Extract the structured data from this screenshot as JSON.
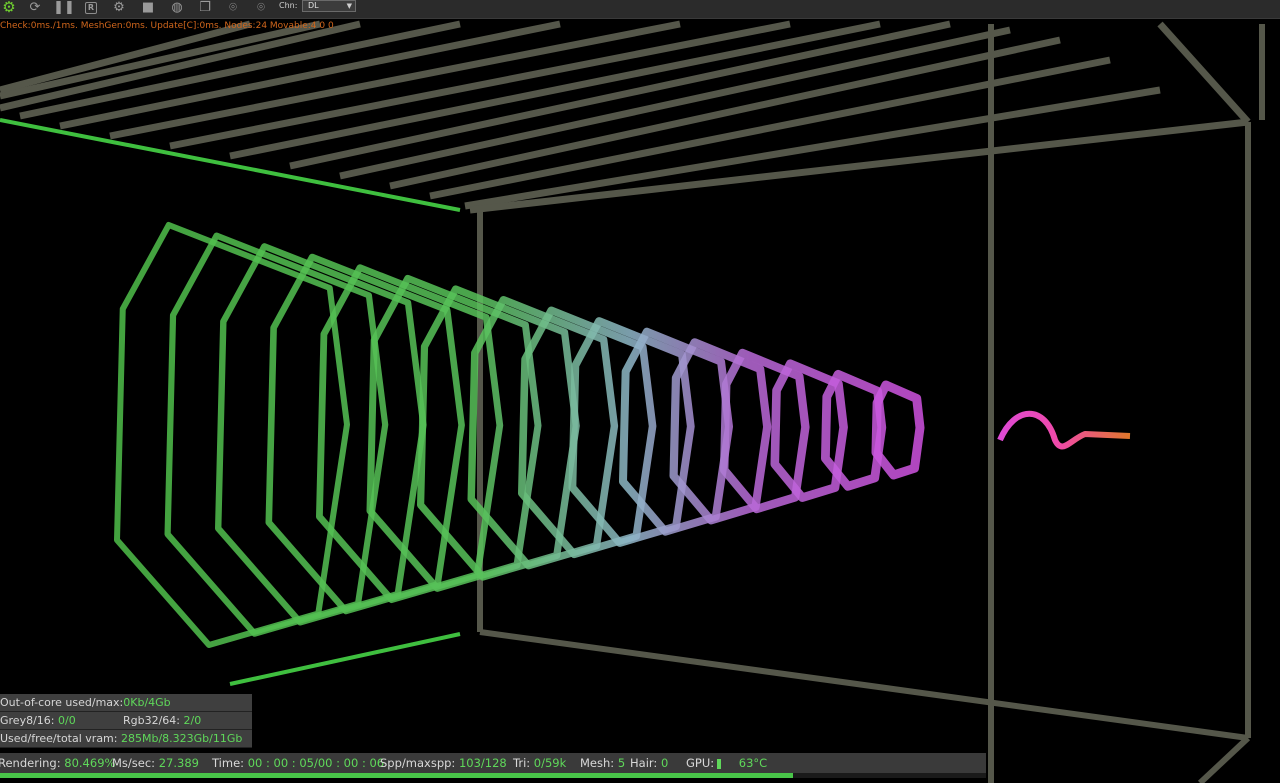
{
  "toolbar": {
    "icons": [
      "settings-gear-icon",
      "refresh-icon",
      "pause-icon",
      "r-button-icon",
      "gear-icon",
      "lock-icon",
      "sphere-icon",
      "copy-icon",
      "map-pin-icon",
      "pin-icon"
    ],
    "chn_label": "Chn:",
    "chn_value": "DL"
  },
  "perf_line": "Check:0ms./1ms. MeshGen:0ms. Update[C]:0ms. Nodes:24 Movable:4 0 0",
  "stats": {
    "out_of_core_label": "Out-of-core used/max:",
    "out_of_core_value": "0Kb/4Gb",
    "grey_label": "Grey8/16:",
    "grey_value": "0/0",
    "rgb_label": "Rgb32/64:",
    "rgb_value": "2/0",
    "vram_label": "Used/free/total vram:",
    "vram_value": "285Mb/8.323Gb/11Gb"
  },
  "statusbar": {
    "rendering_label": "Rendering:",
    "rendering_value": "80.469%",
    "ms_label": "Ms/sec:",
    "ms_value": "27.389",
    "time_label": "Time:",
    "time_value": "00 : 00 : 05/00 : 00 : 06",
    "spp_label": "Spp/maxspp:",
    "spp_value": "103/128",
    "tri_label": "Tri:",
    "tri_value": "0/59k",
    "mesh_label": "Mesh:",
    "mesh_value": "5",
    "hair_label": "Hair:",
    "hair_value": "0",
    "gpu_label": "GPU:",
    "gpu_temp": "63°C"
  },
  "progress_fraction": 0.80469,
  "colors": {
    "value_green": "#5fd85a",
    "perf_orange": "#d0661c",
    "frame_gray": "#55574a",
    "spiral_start": "#4fbf4a",
    "spiral_mid": "#8fb7c8",
    "spiral_magenta": "#d04ae0",
    "spiral_end": "#e0782a"
  }
}
